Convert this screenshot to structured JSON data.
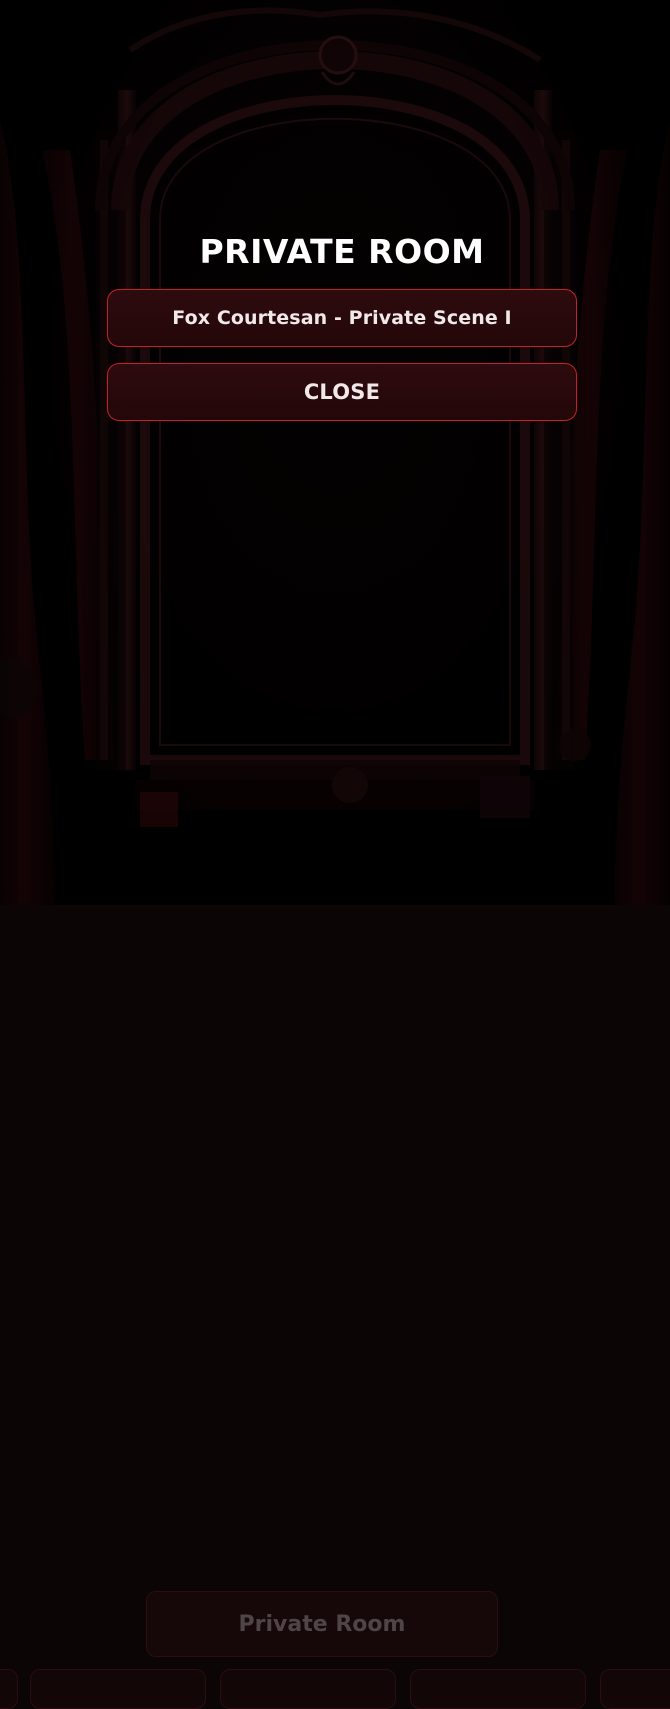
{
  "modal": {
    "title": "PRIVATE ROOM",
    "scene_button_label": "Fox Courtesan - Private Scene I",
    "close_button_label": "CLOSE"
  },
  "background": {
    "private_room_tab_label": "Private Room"
  },
  "colors": {
    "modal_border": "#c5212d",
    "modal_fill": "#2a090c",
    "title": "#ffffff",
    "button_text": "#f1e9e9",
    "bottom_tab_text": "#4f4446"
  }
}
